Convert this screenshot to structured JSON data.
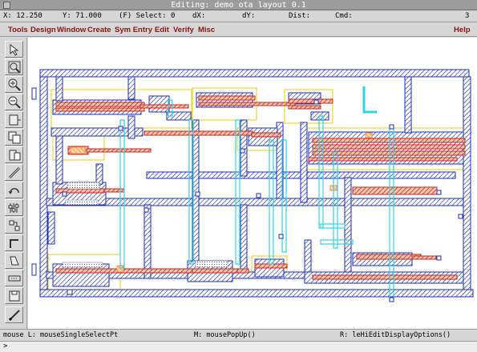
{
  "window": {
    "title": "Editing: demo ota layout 0.1"
  },
  "status": {
    "x": "X: 12.250",
    "y": "Y: 71.000",
    "select": "(F) Select: 0",
    "dx": "dX:",
    "dy": "dY:",
    "dist": "Dist:",
    "cmd": "Cmd:",
    "count": "3"
  },
  "menu": {
    "items": [
      "Tools",
      "Design",
      "Window",
      "Create",
      "Sym Entry",
      "Edit",
      "Verify",
      "Misc"
    ],
    "help": "Help"
  },
  "toolbar": {
    "tools": [
      "select-icon",
      "zoom-fit-icon",
      "zoom-in-icon",
      "zoom-out-icon",
      "stretch-icon",
      "copy-icon",
      "move-icon",
      "ruler-icon",
      "undo-icon",
      "properties-icon",
      "hierarchy-icon",
      "path-icon",
      "label-icon",
      "delete-icon",
      "save-icon",
      "pencil-icon"
    ]
  },
  "mouse": {
    "left": "mouse L: mouseSingleSelectPt",
    "middle": "M: mousePopUp()",
    "right": "R: leHiEditDisplayOptions()"
  },
  "command": {
    "prompt": ">"
  },
  "colors": {
    "metal_blue": "#1d2fb8",
    "poly_red": "#c9261e",
    "active_orange": "#ff8c3c",
    "via_cyan": "#2fd4e6",
    "nwell_yellow": "#e8d200",
    "menu_text": "#8a1410"
  }
}
